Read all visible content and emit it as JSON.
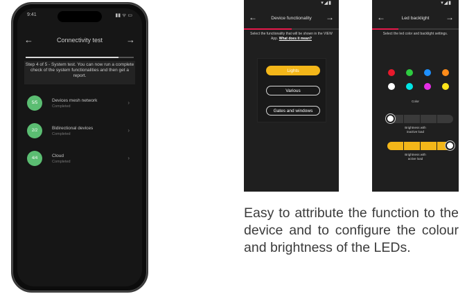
{
  "phone": {
    "status_time": "9:41",
    "status_icons": "▮▮ ᯤ ▭",
    "title": "Connectivity test",
    "info_text": "Step 4 of 5 - System test. You can now run a complete check of the system functionalities and then get a report.",
    "rows": [
      {
        "badge": "5/5",
        "label": "Devices mesh network",
        "sub": "Completed"
      },
      {
        "badge": "2/2",
        "label": "Bidirectional devices",
        "sub": "Completed"
      },
      {
        "badge": "4/4",
        "label": "Cloud",
        "sub": "Completed"
      }
    ],
    "progress": 0.86
  },
  "device_screen": {
    "status_icons": "▾◢▮",
    "title": "Device functionality",
    "description": "Select the functionality that will be shown in the VIEW App.",
    "link": "What does it mean?",
    "progress": 0.5,
    "options": [
      "Lights",
      "Various",
      "Gates and windows"
    ],
    "selected_option": "Lights",
    "accent": "#e8194b",
    "option_color": "#f3b619"
  },
  "led_screen": {
    "status_icons": "▾◢▮",
    "title": "Led backlight",
    "description": "Select the led color and backlight settings.",
    "progress": 0.3,
    "colors": [
      "#e8192c",
      "#2ecc40",
      "#1e90ff",
      "#ff8c1a",
      "#ffffff",
      "#00e5e5",
      "#e62ee6",
      "#ffe51a"
    ],
    "color_label": "Color",
    "inactive_label": "Brightness with\ninactive load",
    "active_label": "Brightness with\nactive load",
    "inactive_level": 0.0,
    "active_level": 1.0,
    "slider_color": "#f3b619"
  },
  "caption": "Easy to attribute the function to the device and to configure the colour and brightness of the LEDs."
}
